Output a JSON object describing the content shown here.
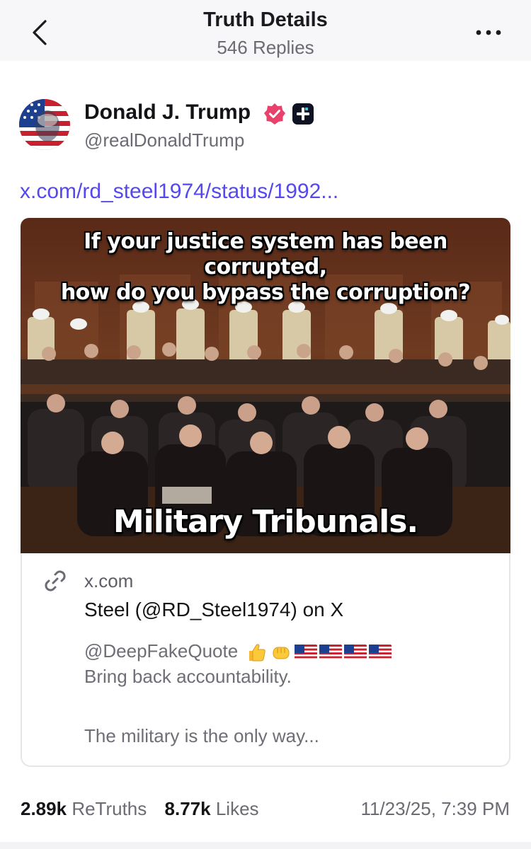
{
  "header": {
    "title": "Truth Details",
    "subtitle": "546 Replies",
    "back_icon": "chevron-left-icon",
    "more_icon": "more-dots-icon"
  },
  "post": {
    "author_name": "Donald J. Trump",
    "author_handle": "@realDonaldTrump",
    "link_text": "x.com/rd_steel1974/status/1992...",
    "image": {
      "caption_line1": "If your justice system has been corrupted,",
      "caption_line2": "how do you bypass the corruption?",
      "caption_bottom": "Military Tribunals."
    },
    "card": {
      "domain": "x.com",
      "title": "Steel (@RD_Steel1974) on X",
      "desc_mention": "@DeepFakeQuote",
      "desc_line2": "Bring back accountability.",
      "desc_line3": "The military is the only way..."
    },
    "stats": {
      "retruths_count": "2.89k",
      "retruths_label": "ReTruths",
      "likes_count": "8.77k",
      "likes_label": "Likes",
      "timestamp": "11/23/25, 7:39 PM"
    }
  },
  "colors": {
    "link": "#5448ee",
    "verified": "#e8416b",
    "muted": "#6b6b73"
  }
}
